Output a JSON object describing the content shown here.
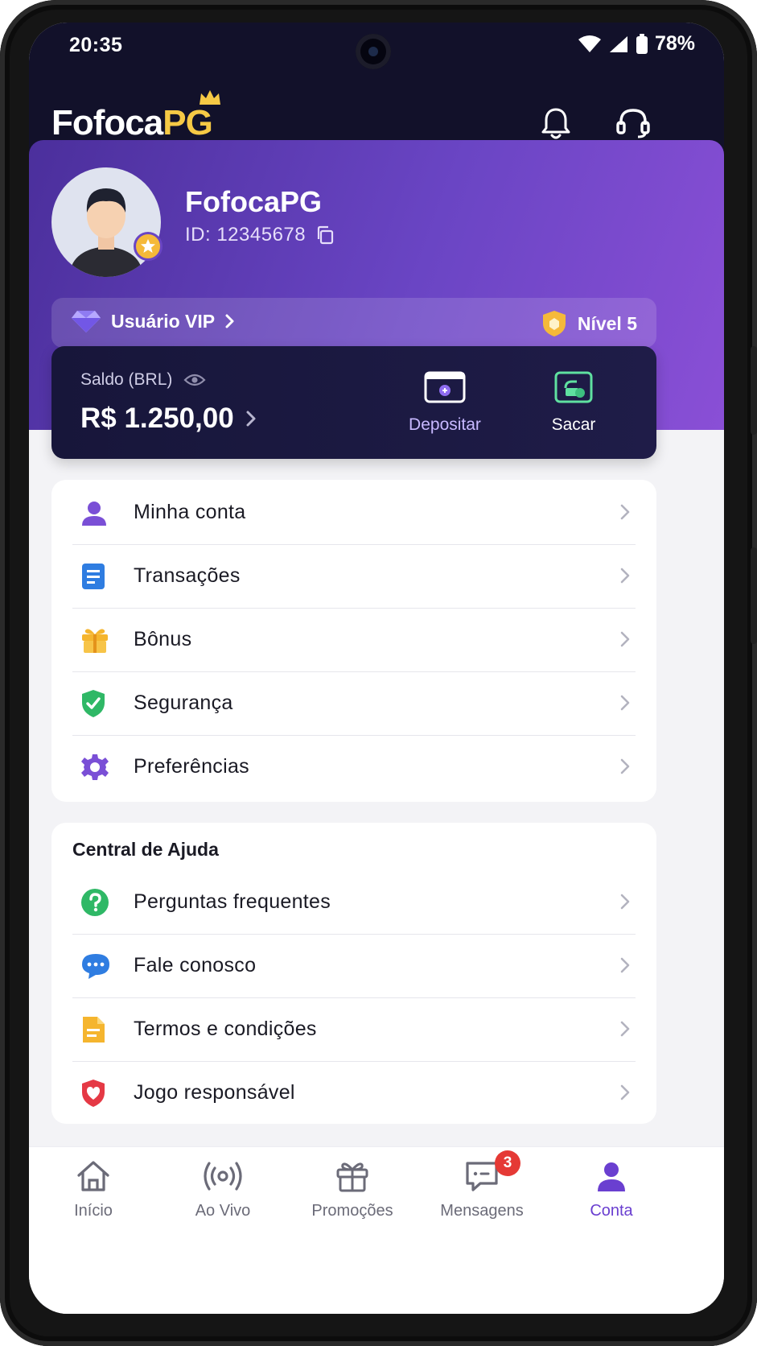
{
  "status_bar": {
    "time": "20:35",
    "battery": "78%"
  },
  "header": {
    "logo_main": "Fofoca",
    "logo_accent": "PG"
  },
  "profile": {
    "name": "FofocaPG",
    "id_text": "ID: 12345678",
    "vip_label": "Usuário VIP",
    "level_label": "Nível 5"
  },
  "balance": {
    "label": "Saldo (BRL)",
    "value": "R$ 1.250,00",
    "deposit_label": "Depositar",
    "withdraw_label": "Sacar"
  },
  "account_menu": [
    {
      "label": "Minha conta",
      "icon": "user-icon"
    },
    {
      "label": "Transações",
      "icon": "document-icon"
    },
    {
      "label": "Bônus",
      "icon": "gift-icon"
    },
    {
      "label": "Segurança",
      "icon": "shield-check-icon"
    },
    {
      "label": "Preferências",
      "icon": "gear-icon"
    }
  ],
  "help": {
    "title": "Central de Ajuda",
    "items": [
      {
        "label": "Perguntas frequentes",
        "icon": "question-icon"
      },
      {
        "label": "Fale conosco",
        "icon": "chat-icon"
      },
      {
        "label": "Termos e condições",
        "icon": "file-icon"
      },
      {
        "label": "Jogo responsável",
        "icon": "heart-shield-icon"
      }
    ]
  },
  "bottom_nav": [
    {
      "label": "Início",
      "icon": "home-icon"
    },
    {
      "label": "Ao Vivo",
      "icon": "live-icon"
    },
    {
      "label": "Promoções",
      "icon": "gift-icon"
    },
    {
      "label": "Mensagens",
      "icon": "message-icon",
      "badge": "3"
    },
    {
      "label": "Conta",
      "icon": "account-icon",
      "active": true
    }
  ],
  "colors": {
    "accent": "#6a3fd0",
    "header_bg": "#12112a",
    "logo_gold": "#f6c945",
    "badge_red": "#e53935"
  }
}
